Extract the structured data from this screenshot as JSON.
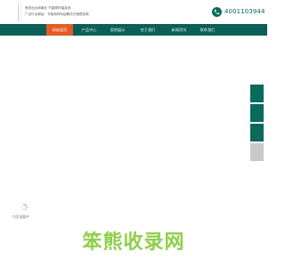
{
  "header": {
    "tagline_line1": "有机也太和事业 节能物环保技术",
    "tagline_line2": "广泛行业和起 · 节能和材料证解决方案提供商",
    "phone_icon": "phone-icon",
    "phone_number": "4001103944"
  },
  "nav": {
    "items": [
      {
        "label": "网站首页",
        "active": true
      },
      {
        "label": "产品中心",
        "active": false
      },
      {
        "label": "案例展示",
        "active": false
      },
      {
        "label": "关于我们",
        "active": false
      },
      {
        "label": "新闻资讯",
        "active": false
      },
      {
        "label": "联系我们",
        "active": false
      }
    ]
  },
  "side_floats": [
    {
      "icon": "chat-icon",
      "color": "#0a6a5c"
    },
    {
      "icon": "phone-icon",
      "color": "#0a6a5c"
    },
    {
      "icon": "qrcode-icon",
      "color": "#0a6a5c"
    },
    {
      "icon": "back-to-top-icon",
      "color": "#c9c9c9"
    }
  ],
  "main": {
    "loading_icon": "spinner-icon",
    "loading_text": "内页加载中"
  },
  "watermark": {
    "text": "笨熊收录网"
  },
  "colors": {
    "brand": "#0a5f56",
    "accent": "#e35b26",
    "watermark": "#8fcf4a"
  }
}
